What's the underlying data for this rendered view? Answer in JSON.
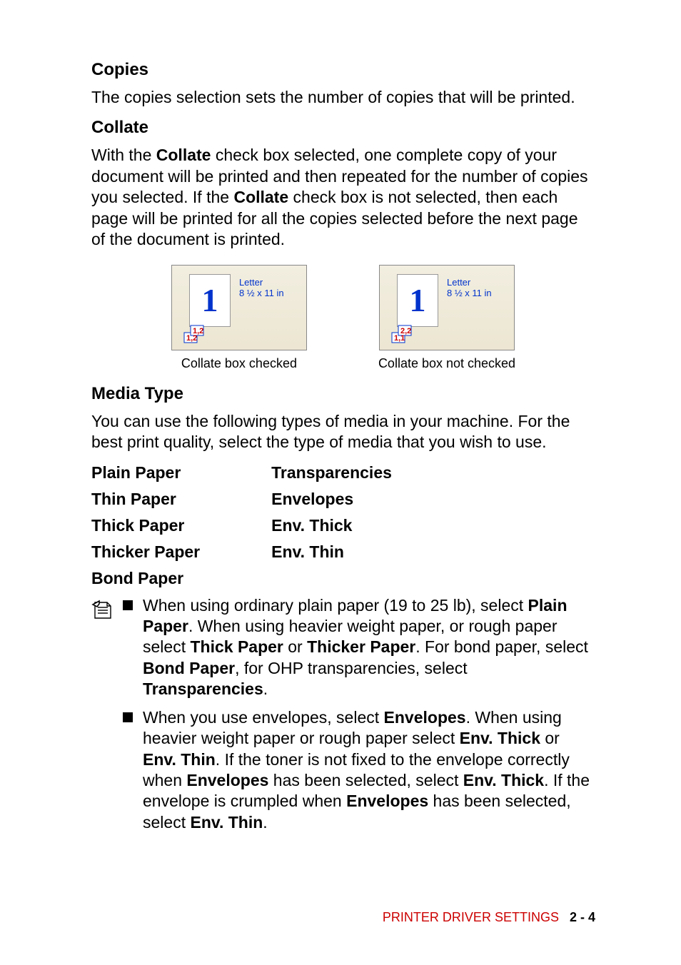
{
  "section1": {
    "heading": "Copies",
    "text": "The copies selection sets the number of copies that will be printed."
  },
  "section2": {
    "heading": "Collate",
    "text_before": "With the ",
    "bold1": "Collate",
    "text_mid1": " check box selected, one complete copy of your document will be printed and then repeated for the number of copies you selected. If the ",
    "bold2": "Collate",
    "text_after": " check box is not selected, then each page will be printed for all the copies selected before the next page of the document is printed."
  },
  "images": {
    "letter_label": "Letter",
    "size_label": "8 ½ x 11 in",
    "numeral": "1",
    "stack_a1": "1,2",
    "stack_a2": "1,2",
    "stack_b1": "2,2",
    "stack_b2": "1,1",
    "caption_left": "Collate box checked",
    "caption_right": "Collate box not checked"
  },
  "section3": {
    "heading": "Media Type",
    "text": "You can use the following types of media in your machine. For the best print quality, select the type of media that you wish to use."
  },
  "media": {
    "col1": [
      "Plain Paper",
      "Thin Paper",
      "Thick Paper",
      "Thicker Paper",
      "Bond Paper"
    ],
    "col2": [
      "Transparencies",
      "Envelopes",
      "Env. Thick",
      "Env. Thin"
    ]
  },
  "notes": {
    "n1": {
      "t1": "When using ordinary plain paper (19 to 25 lb), select ",
      "b1": "Plain Paper",
      "t2": ". When using heavier weight paper, or rough paper select ",
      "b2": "Thick Paper",
      "t3": " or ",
      "b3": "Thicker Paper",
      "t4": ". For bond paper, select ",
      "b4": "Bond Paper",
      "t5": ", for OHP transparencies, select ",
      "b5": "Transparencies",
      "t6": "."
    },
    "n2": {
      "t1": "When you use envelopes, select ",
      "b1": "Envelopes",
      "t2": ". When using heavier weight paper or rough paper select ",
      "b2": "Env. Thick",
      "t3": " or ",
      "b3": "Env. Thin",
      "t4": ". If the toner is not fixed to the envelope correctly when ",
      "b4": "Envelopes",
      "t5": " has been selected, select ",
      "b5": "Env. Thick",
      "t6": ". If the envelope is crumpled when ",
      "b6": "Envelopes",
      "t7": " has been selected, select ",
      "b7": "Env. Thin",
      "t8": "."
    }
  },
  "footer": {
    "text": "PRINTER DRIVER SETTINGS",
    "page": "2 - 4"
  }
}
